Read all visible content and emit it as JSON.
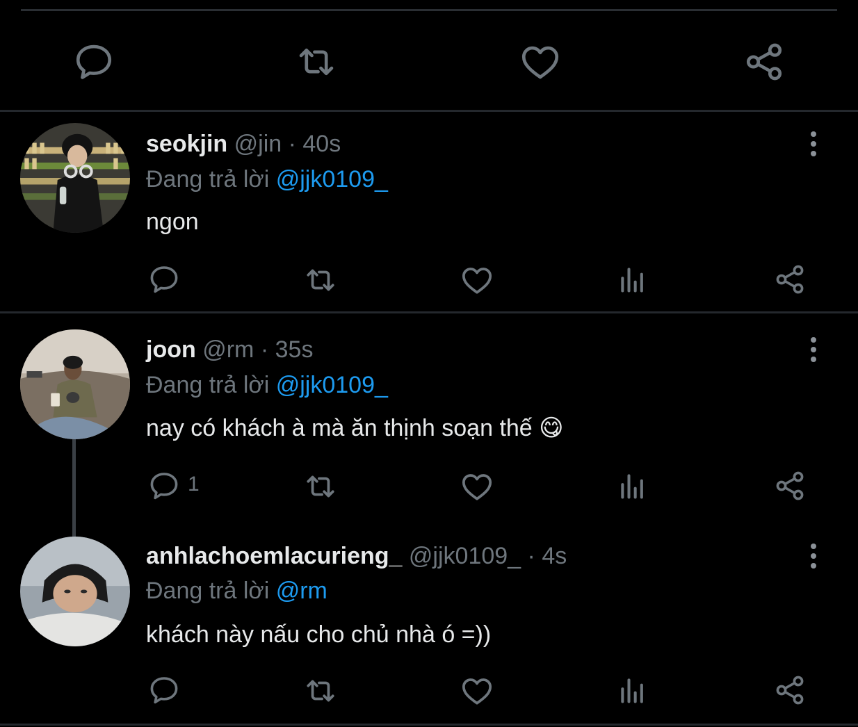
{
  "colors": {
    "background": "#000000",
    "text": "#e7e9ea",
    "muted": "#6e767d",
    "accent": "#1d9bf0",
    "divider": "#24282d"
  },
  "top_actions": {
    "icons": [
      "reply-icon",
      "retweet-icon",
      "like-icon",
      "share-icon"
    ]
  },
  "replies": [
    {
      "name": "seokjin",
      "handle": "@jin",
      "separator": "·",
      "time": "40s",
      "replying_prefix": "Đang trả lời",
      "replying_to": "@jjk0109_",
      "text": "ngon",
      "reply_count": "",
      "actions": [
        "reply-icon",
        "retweet-icon",
        "like-icon",
        "analytics-icon",
        "share-icon"
      ]
    },
    {
      "name": "joon",
      "handle": "@rm",
      "separator": "·",
      "time": "35s",
      "replying_prefix": "Đang trả lời",
      "replying_to": "@jjk0109_",
      "text": "nay có khách à mà ăn thịnh soạn thế",
      "emoji": "😋",
      "reply_count": "1",
      "actions": [
        "reply-icon",
        "retweet-icon",
        "like-icon",
        "analytics-icon",
        "share-icon"
      ]
    },
    {
      "name": "anhlachoemlacurieng_",
      "handle": "@jjk0109_",
      "separator": "·",
      "time": "4s",
      "replying_prefix": "Đang trả lời",
      "replying_to": "@rm",
      "text": "khách này nấu cho chủ nhà ó =))",
      "reply_count": "",
      "actions": [
        "reply-icon",
        "retweet-icon",
        "like-icon",
        "analytics-icon",
        "share-icon"
      ]
    }
  ]
}
